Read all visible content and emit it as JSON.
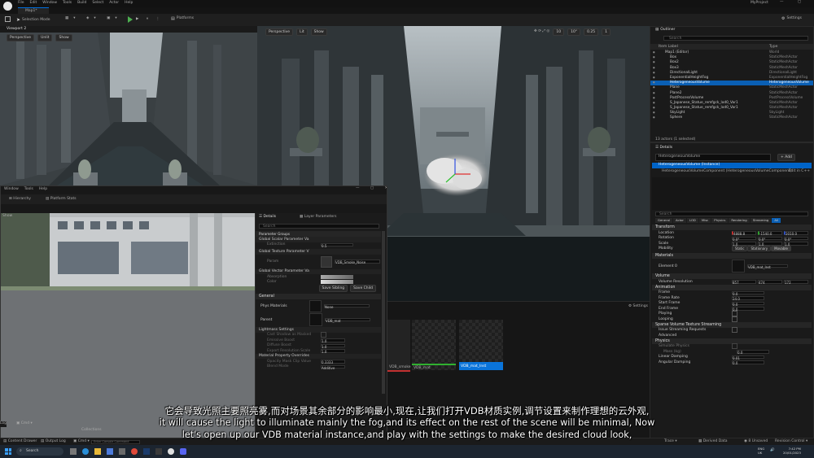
{
  "menu": {
    "items": [
      "File",
      "Edit",
      "Window",
      "Tools",
      "Build",
      "Select",
      "Actor",
      "Help"
    ],
    "project": "MyProject"
  },
  "level_tab": "Map1*",
  "toolbar": {
    "mode": "Selection Mode",
    "platforms": "Platforms",
    "settings": "Settings"
  },
  "viewport1": {
    "tab": "Viewport 2",
    "perspective": "Perspective",
    "lit": "Unlit",
    "show": "Show"
  },
  "viewport_main": {
    "perspective": "Perspective",
    "lit": "Lit",
    "show": "Show",
    "snap_grid": "10",
    "snap_rot": "10°",
    "snap_scale": "0.25",
    "cam_speed": "1"
  },
  "outliner": {
    "title": "Outliner",
    "search_placeholder": "Search",
    "col_label": "Item Label",
    "col_type": "Type",
    "items": [
      {
        "label": "Map1 (Editor)",
        "type": "World"
      },
      {
        "label": "Box",
        "type": "StaticMeshActor"
      },
      {
        "label": "Box2",
        "type": "StaticMeshActor"
      },
      {
        "label": "Box3",
        "type": "StaticMeshActor"
      },
      {
        "label": "DirectionalLight",
        "type": "DirectionalLight"
      },
      {
        "label": "ExponentialHeightFog",
        "type": "ExponentialHeightFog"
      },
      {
        "label": "HeterogeneousVolume",
        "type": "HeterogeneousVolume"
      },
      {
        "label": "Plane",
        "type": "StaticMeshActor"
      },
      {
        "label": "Plane2",
        "type": "StaticMeshActor"
      },
      {
        "label": "PostProcessVolume",
        "type": "PostProcessVolume"
      },
      {
        "label": "S_Japanese_Statue_remfgck_lod0_Var1",
        "type": "StaticMeshActor"
      },
      {
        "label": "S_Japanese_Statue_remfgck_lod0_Var1",
        "type": "StaticMeshActor"
      },
      {
        "label": "SkyLight",
        "type": "SkyLight"
      },
      {
        "label": "Sphere",
        "type": "StaticMeshActor"
      }
    ],
    "status": "13 actors (1 selected)"
  },
  "details": {
    "title": "Details",
    "actor": "HeterogeneousVolume",
    "add": "+ Add",
    "instance": "HeterogeneousVolume (Instance)",
    "component": "HeterogeneousVolumeComponent (HeterogeneousVolumeComponent)",
    "edit": "Edit in C++",
    "search": "Search",
    "tabs": [
      "General",
      "Actor",
      "LOD",
      "Misc",
      "Physics",
      "Rendering",
      "Streaming",
      "All"
    ],
    "sections": {
      "transform": "Transform",
      "materials": "Materials",
      "volume": "Volume",
      "animation": "Animation",
      "svt": "Sparse Volume Texture Streaming",
      "advanced": "Advanced",
      "physics": "Physics"
    },
    "labels": {
      "location": "Location",
      "rotation": "Rotation",
      "scale": "Scale",
      "mobility": "Mobility",
      "element": "Element 0",
      "resolution": "Volume Resolution",
      "frame": "Frame",
      "frame_rate": "Frame Rate",
      "start_frame": "Start Frame",
      "end_frame": "End Frame",
      "playing": "Playing",
      "looping": "Looping",
      "issue": "Issue Streaming Requests",
      "sim": "Simulate Physics",
      "mass": "Mass (kg)",
      "lin": "Linear Damping",
      "ang": "Angular Damping"
    },
    "location": [
      "4888.8",
      "-1540.0",
      "2010.0"
    ],
    "rotation": [
      "0.0°",
      "0.0°",
      "0.0°"
    ],
    "scale": [
      "1.0",
      "1.0",
      "1.0"
    ],
    "mobility": [
      "Static",
      "Stationary",
      "Movable"
    ],
    "material": "VDB_mat_Inst",
    "resolution": [
      "857",
      "474",
      "172"
    ],
    "frame": "0.0",
    "frame_rate": "24.0",
    "start_frame": "0.0",
    "end_frame": "0.0",
    "mass": "0.0",
    "lin": "0.01",
    "ang": "0.0"
  },
  "mat_window": {
    "menu": [
      "Window",
      "Tools",
      "Help"
    ],
    "hierarchy": "Hierarchy",
    "platform": "Platform Stats",
    "show": "Show"
  },
  "mat_details": {
    "tab": "Details",
    "tab2": "Layer Parameters",
    "search": "Search",
    "groups": "Parameter Groups",
    "scalar": "Global Scalar Parameter Va",
    "texture": "Global Texture Parameter V",
    "vector": "Global Vector Parameter Va",
    "scalar_field": "Extinction",
    "scalar_val": "0.5",
    "tex_field": "Param",
    "tex_val": "VDB_Smoke_Noise",
    "vec_fields": [
      "Absorption",
      "Color"
    ],
    "save_sibling": "Save Sibling",
    "save_child": "Save Child",
    "general": "General",
    "phys": "Phys Materials",
    "phys_val": "None",
    "parent": "Parent",
    "parent_val": "VDB_mat",
    "lightmass": "Lightmass Settings",
    "lm_rows": [
      "Cast Shadow as Masked",
      "Emissive Boost",
      "Diffuse Boost",
      "Export Resolution Scale"
    ],
    "lm_vals": [
      "",
      "1.0",
      "1.0",
      "1.0"
    ],
    "mat_prop": "Material Property Overrides",
    "mp_rows": [
      "Opacity Mask Clip Value",
      "Blend Mode"
    ],
    "mp_vals": [
      "0.3333",
      "Additive"
    ]
  },
  "content": {
    "settings": "Settings",
    "assets": [
      "VDB_smoke",
      "VDB_mat",
      "VDB_mat_Inst"
    ],
    "collections": "Collections"
  },
  "bottom": {
    "content_drawer": "Content Drawer",
    "output_log": "Output Log",
    "cmd": "Cmd",
    "cmd_placeholder": "Enter Console Command",
    "trace": "Trace",
    "derived": "Derived Data",
    "unsaved": "8 Unsaved",
    "revision": "Revision Control"
  },
  "taskbar": {
    "search": "Search",
    "time": "7:42 PM",
    "date": "20/01/2023",
    "lang": "ENG",
    "region": "UK"
  },
  "subtitle": {
    "cn": "它会导致光照主要照亮雾,而对场景其余部分的影响最小,现在,让我们打开VDB材质实例,调节设置来制作理想的云外观,",
    "en1": "it will cause the light to illuminate mainly the fog,and its effect on the rest of the scene will be minimal, Now",
    "en2": "let's open up our VDB material instance,and play with the settings to make the desired cloud look,"
  }
}
